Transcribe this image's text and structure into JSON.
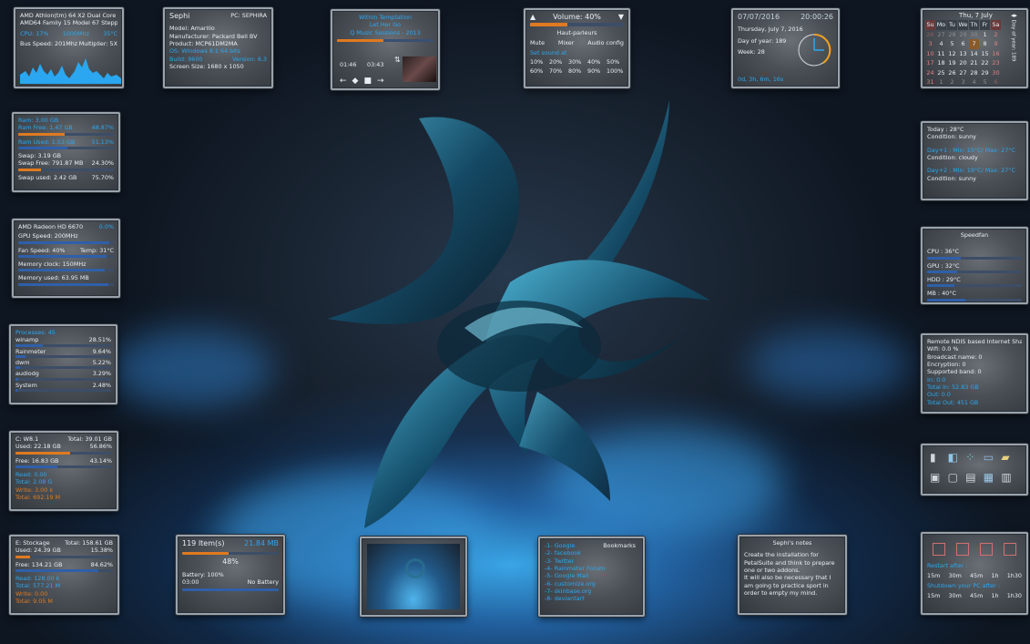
{
  "cpu": {
    "line1": "AMD Athlon(tm) 64 X2 Dual Core P...",
    "line2": "AMD64 Family 15 Model 67 Steppin...",
    "usage": "CPU: 17%",
    "freq": "1000Mhz",
    "temp": "35°C",
    "bus": "Bus Speed: 201Mhz",
    "mult": "Multiplier: 5X"
  },
  "sys": {
    "user": "Sephi",
    "pc": "PC: SEPHIRA",
    "model": "Model: Amarillo",
    "manufacturer": "Manufacturer: Packard Bell BV",
    "product": "Product: MCP61DM2MA",
    "os": "OS: Windows 8.1 64 bits",
    "build": "Build: 9600",
    "version": "Version: 6.3",
    "screen": "Screen Size: 1680 x 1050"
  },
  "music": {
    "artist": "Within Temptation",
    "track": "Let Her Go",
    "album": "Q Music Sessions - 2013",
    "elapsed": "01:46",
    "total": "03:43",
    "progress": 0.48
  },
  "volume": {
    "title": "Volume: 40%",
    "device": "Haut-parleurs",
    "mute": "Mute",
    "mixer": "Mixer",
    "config": "Audio config",
    "set_label": "Set sound at",
    "levels": [
      "10%",
      "20%",
      "30%",
      "40%",
      "50%",
      "60%",
      "70%",
      "80%",
      "90%",
      "100%"
    ],
    "level": 0.4
  },
  "clock": {
    "date": "07/07/2016",
    "time": "20:00:26",
    "full_date": "Thursday, July 7, 2016",
    "day_of_year": "Day of year: 189",
    "week": "Week: 28",
    "uptime": "0d, 3h, 6m, 16s"
  },
  "calendar": {
    "title": "Thu, 7 July",
    "weekdays": [
      "Su",
      "Mo",
      "Tu",
      "We",
      "Th",
      "Fr",
      "Sa"
    ],
    "days": [
      "26",
      "27",
      "28",
      "29",
      "30",
      "1",
      "2",
      "3",
      "4",
      "5",
      "6",
      "7",
      "8",
      "9",
      "10",
      "11",
      "12",
      "13",
      "14",
      "15",
      "16",
      "17",
      "18",
      "19",
      "20",
      "21",
      "22",
      "23",
      "24",
      "25",
      "26",
      "27",
      "28",
      "29",
      "30",
      "31",
      "1",
      "2",
      "3",
      "4",
      "5",
      "6"
    ],
    "side1": "Day of year: 189",
    "side2": "Week: 28 Of 52"
  },
  "ram": {
    "ram": "Ram: 3.00 GB",
    "free": "Ram Free: 1.47 GB",
    "free_pct": "48.87%",
    "used": "Ram Used: 1.53 GB",
    "used_pct": "51.13%",
    "swap": "Swap: 3.19 GB",
    "swap_free": "Swap Free: 791.87 MB",
    "swap_free_pct": "24.30%",
    "swap_used": "Swap used: 2.42 GB",
    "swap_used_pct": "75.70%",
    "v1": 0.49,
    "v2": 0.51,
    "v3": 0.24,
    "v4": 0.76
  },
  "gpu": {
    "name": "AMD Radeon HD 6670",
    "pct": "0.0%",
    "speed": "GPU Speed: 200MHz",
    "fan": "Fan Speed: 40%",
    "temp": "Temp: 31°C",
    "clock": "Memory clock: 150MHz",
    "mem": "Memory used: 63.95 MB"
  },
  "proc": {
    "title": "Processes: 45",
    "items": [
      {
        "name": "winamp",
        "pct": "28.51%",
        "v": 0.29
      },
      {
        "name": "Rainmeter",
        "pct": "9.64%",
        "v": 0.1
      },
      {
        "name": "dwm",
        "pct": "5.22%",
        "v": 0.05
      },
      {
        "name": "audiodg",
        "pct": "3.29%",
        "v": 0.03
      },
      {
        "name": "System",
        "pct": "2.48%",
        "v": 0.02
      }
    ]
  },
  "diskc": {
    "name": "C: W8.1",
    "total": "Total: 39.01 GB",
    "used": "Used: 22.18 GB",
    "used_pct": "56.86%",
    "free": "Free: 16.83 GB",
    "free_pct": "43.14%",
    "read": "Read: 0.00",
    "total_r": "Total: 2.08 G",
    "write": "Write: 3.00 k",
    "total_w": "Total: 692.19 M",
    "v1": 0.57,
    "v2": 0.43
  },
  "diske": {
    "name": "E: Stockage",
    "total": "Total: 158.61 GB",
    "used": "Used: 24.39 GB",
    "used_pct": "15.38%",
    "free": "Free: 134.21 GB",
    "free_pct": "84.62%",
    "read": "Read: 128.00 k",
    "total_r": "Total: 577.21 M",
    "write": "Write: 0.00",
    "total_w": "Total: 9.05 M",
    "v1": 0.15,
    "v2": 0.85
  },
  "bin": {
    "items": "119 Item(s)",
    "size": "21.84 MB",
    "pct": "48%",
    "battery": "Battery: 100%",
    "time": "03:00",
    "status": "No Battery",
    "v": 0.48
  },
  "bookmarks": {
    "title": "Bookmarks",
    "items": [
      "-1-  Google",
      "-2-  facebook",
      "-3-  Twitter",
      "-4-  Rainmeter Forum",
      "-5-  Google Mail",
      "-6-  customize.org",
      "-7-  skinbase.org",
      "-8-  deviantart"
    ]
  },
  "notes": {
    "title": "Sephi's notes",
    "text": "Create the installation for PetalSuite and think to prepare one or two addons.\nIt will also be necessary that I am going to practice sport in order to empty my mind."
  },
  "weather": {
    "today": "Today : 28°C",
    "c0": "Condition: sunny",
    "d1": "Day+1 : Min: 15°C/ Max: 27°C",
    "c1": "Condition: cloudy",
    "d2": "Day+2 : Min: 19°C/ Max: 27°C",
    "c2": "Condition: sunny"
  },
  "speedfan": {
    "title": "Speedfan",
    "cpu": "CPU : 36°C",
    "gpu": "GPU : 32°C",
    "hdd": "HDD : 29°C",
    "mb": "MB : 40°C"
  },
  "net": {
    "name": "Remote NDIS based Internet Sharin...",
    "wifi": "Wifi: 0.0 %",
    "bcast": "Broadcast name: 0",
    "enc": "Encryption: 0",
    "band": "Supported band: 0",
    "in": "In: 0.0",
    "total_in": "Total In: 52.83 GB",
    "out": "Out: 0.0",
    "total_out": "Total Out: 451 GB"
  },
  "shutdown": {
    "restart": "Restart after :",
    "shutdown": "Shutdown your PC after :",
    "times": [
      "15m",
      "30m",
      "45m",
      "1h",
      "1h30"
    ]
  }
}
